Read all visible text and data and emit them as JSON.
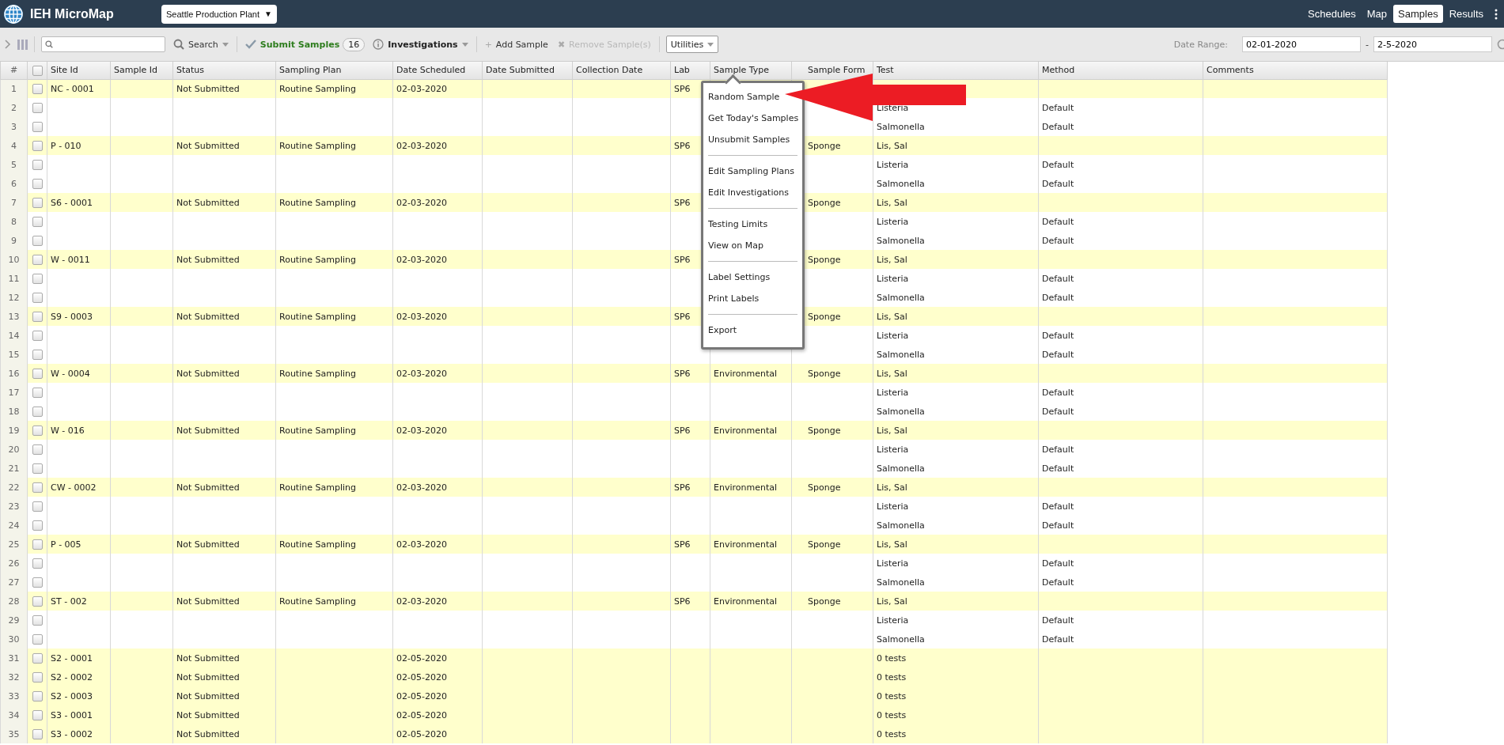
{
  "app": {
    "title": "IEH MicroMap",
    "plant_selector": {
      "value": "Seattle Production Plant",
      "caret": "▼"
    }
  },
  "nav": [
    {
      "label": "Schedules",
      "selected": false
    },
    {
      "label": "Map",
      "selected": false
    },
    {
      "label": "Samples",
      "selected": true
    },
    {
      "label": "Results",
      "selected": false
    }
  ],
  "toolbar": {
    "search_button": "Search",
    "submit": {
      "label": "Submit Samples",
      "count": "16"
    },
    "investigations": "Investigations",
    "add": {
      "icon": "+",
      "label": "Add Sample"
    },
    "remove": {
      "icon": "✖",
      "label": "Remove Sample(s)",
      "disabled": true
    },
    "utilities": {
      "label": "Utilities",
      "expanded": true
    },
    "date_range": {
      "label": "Date Range:",
      "from": "02-01-2020",
      "separator": "-",
      "to": "2-5-2020"
    }
  },
  "table": {
    "columns": [
      "#",
      "Site Id",
      "Sample Id",
      "Status",
      "Sampling Plan",
      "Date Scheduled",
      "Date Submitted",
      "Collection Date",
      "Lab",
      "Sample Type",
      "Sample Form",
      "Test",
      "Method",
      "Comments"
    ],
    "header_checked": false,
    "rows": [
      {
        "num": "1",
        "kind": "sample",
        "checked": false,
        "site_id": "NC - 0001",
        "status": "Not Submitted",
        "sampling_plan": "Routine Sampling",
        "date_scheduled": "02-03-2020",
        "lab": "SP6"
      },
      {
        "num": "2",
        "kind": "test",
        "checked": false,
        "test": "Listeria",
        "method": "Default"
      },
      {
        "num": "3",
        "kind": "test",
        "checked": false,
        "test": "Salmonella",
        "method": "Default"
      },
      {
        "num": "4",
        "kind": "sample",
        "checked": false,
        "site_id": "P - 010",
        "status": "Not Submitted",
        "sampling_plan": "Routine Sampling",
        "date_scheduled": "02-03-2020",
        "lab": "SP6",
        "sample_form": "Sponge",
        "test": "Lis, Sal"
      },
      {
        "num": "5",
        "kind": "test",
        "checked": false,
        "test": "Listeria",
        "method": "Default"
      },
      {
        "num": "6",
        "kind": "test",
        "checked": false,
        "test": "Salmonella",
        "method": "Default"
      },
      {
        "num": "7",
        "kind": "sample",
        "checked": false,
        "site_id": "S6 - 0001",
        "status": "Not Submitted",
        "sampling_plan": "Routine Sampling",
        "date_scheduled": "02-03-2020",
        "lab": "SP6",
        "sample_form": "Sponge",
        "test": "Lis, Sal"
      },
      {
        "num": "8",
        "kind": "test",
        "checked": false,
        "test": "Listeria",
        "method": "Default"
      },
      {
        "num": "9",
        "kind": "test",
        "checked": false,
        "test": "Salmonella",
        "method": "Default"
      },
      {
        "num": "10",
        "kind": "sample",
        "checked": false,
        "site_id": "W - 0011",
        "status": "Not Submitted",
        "sampling_plan": "Routine Sampling",
        "date_scheduled": "02-03-2020",
        "lab": "SP6",
        "sample_form": "Sponge",
        "test": "Lis, Sal"
      },
      {
        "num": "11",
        "kind": "test",
        "checked": false,
        "test": "Listeria",
        "method": "Default"
      },
      {
        "num": "12",
        "kind": "test",
        "checked": false,
        "test": "Salmonella",
        "method": "Default"
      },
      {
        "num": "13",
        "kind": "sample",
        "checked": false,
        "site_id": "S9 - 0003",
        "status": "Not Submitted",
        "sampling_plan": "Routine Sampling",
        "date_scheduled": "02-03-2020",
        "lab": "SP6",
        "sample_form": "Sponge",
        "test": "Lis, Sal"
      },
      {
        "num": "14",
        "kind": "test",
        "checked": false,
        "test": "Listeria",
        "method": "Default"
      },
      {
        "num": "15",
        "kind": "test",
        "checked": false,
        "test": "Salmonella",
        "method": "Default"
      },
      {
        "num": "16",
        "kind": "sample",
        "checked": false,
        "site_id": "W - 0004",
        "status": "Not Submitted",
        "sampling_plan": "Routine Sampling",
        "date_scheduled": "02-03-2020",
        "lab": "SP6",
        "sample_type": "Environmental",
        "sample_form": "Sponge",
        "test": "Lis, Sal"
      },
      {
        "num": "17",
        "kind": "test",
        "checked": false,
        "test": "Listeria",
        "method": "Default"
      },
      {
        "num": "18",
        "kind": "test",
        "checked": false,
        "test": "Salmonella",
        "method": "Default"
      },
      {
        "num": "19",
        "kind": "sample",
        "checked": false,
        "site_id": "W - 016",
        "status": "Not Submitted",
        "sampling_plan": "Routine Sampling",
        "date_scheduled": "02-03-2020",
        "lab": "SP6",
        "sample_type": "Environmental",
        "sample_form": "Sponge",
        "test": "Lis, Sal"
      },
      {
        "num": "20",
        "kind": "test",
        "checked": false,
        "test": "Listeria",
        "method": "Default"
      },
      {
        "num": "21",
        "kind": "test",
        "checked": false,
        "test": "Salmonella",
        "method": "Default"
      },
      {
        "num": "22",
        "kind": "sample",
        "checked": false,
        "site_id": "CW - 0002",
        "status": "Not Submitted",
        "sampling_plan": "Routine Sampling",
        "date_scheduled": "02-03-2020",
        "lab": "SP6",
        "sample_type": "Environmental",
        "sample_form": "Sponge",
        "test": "Lis, Sal"
      },
      {
        "num": "23",
        "kind": "test",
        "checked": false,
        "test": "Listeria",
        "method": "Default"
      },
      {
        "num": "24",
        "kind": "test",
        "checked": false,
        "test": "Salmonella",
        "method": "Default"
      },
      {
        "num": "25",
        "kind": "sample",
        "checked": false,
        "site_id": "P - 005",
        "status": "Not Submitted",
        "sampling_plan": "Routine Sampling",
        "date_scheduled": "02-03-2020",
        "lab": "SP6",
        "sample_type": "Environmental",
        "sample_form": "Sponge",
        "test": "Lis, Sal"
      },
      {
        "num": "26",
        "kind": "test",
        "checked": false,
        "test": "Listeria",
        "method": "Default"
      },
      {
        "num": "27",
        "kind": "test",
        "checked": false,
        "test": "Salmonella",
        "method": "Default"
      },
      {
        "num": "28",
        "kind": "sample",
        "checked": false,
        "site_id": "ST - 002",
        "status": "Not Submitted",
        "sampling_plan": "Routine Sampling",
        "date_scheduled": "02-03-2020",
        "lab": "SP6",
        "sample_type": "Environmental",
        "sample_form": "Sponge",
        "test": "Lis, Sal"
      },
      {
        "num": "29",
        "kind": "test",
        "checked": false,
        "test": "Listeria",
        "method": "Default"
      },
      {
        "num": "30",
        "kind": "test",
        "checked": false,
        "test": "Salmonella",
        "method": "Default"
      },
      {
        "num": "31",
        "kind": "sample",
        "checked": false,
        "site_id": "S2 - 0001",
        "status": "Not Submitted",
        "date_scheduled": "02-05-2020",
        "test": "0 tests"
      },
      {
        "num": "32",
        "kind": "sample",
        "checked": false,
        "site_id": "S2 - 0002",
        "status": "Not Submitted",
        "date_scheduled": "02-05-2020",
        "test": "0 tests"
      },
      {
        "num": "33",
        "kind": "sample",
        "checked": false,
        "site_id": "S2 - 0003",
        "status": "Not Submitted",
        "date_scheduled": "02-05-2020",
        "test": "0 tests"
      },
      {
        "num": "34",
        "kind": "sample",
        "checked": false,
        "site_id": "S3 - 0001",
        "status": "Not Submitted",
        "date_scheduled": "02-05-2020",
        "test": "0 tests"
      },
      {
        "num": "35",
        "kind": "sample",
        "checked": false,
        "site_id": "S3 - 0002",
        "status": "Not Submitted",
        "date_scheduled": "02-05-2020",
        "test": "0 tests"
      }
    ]
  },
  "utilities_menu": {
    "groups": [
      [
        "Random Sample",
        "Get Today's Samples",
        "Unsubmit Samples"
      ],
      [
        "Edit Sampling Plans",
        "Edit Investigations"
      ],
      [
        "Testing Limits",
        "View on Map"
      ],
      [
        "Label Settings",
        "Print Labels"
      ],
      [
        "Export"
      ]
    ]
  }
}
